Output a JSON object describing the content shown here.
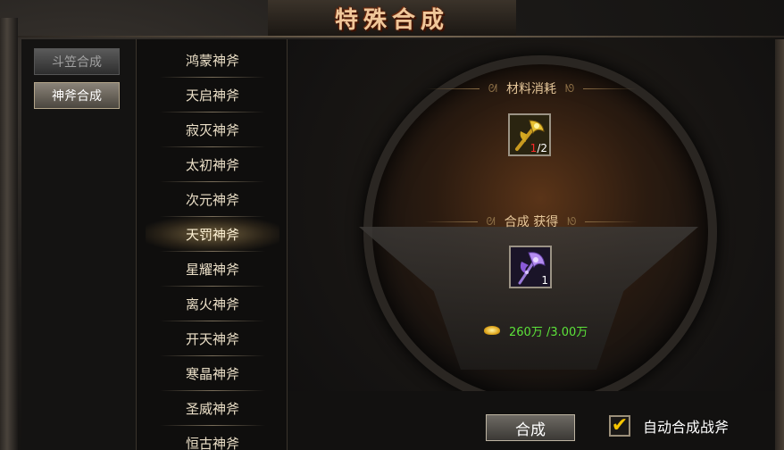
{
  "title": "特殊合成",
  "tabs": [
    {
      "label": "斗笠合成",
      "active": false
    },
    {
      "label": "神斧合成",
      "active": true
    }
  ],
  "list": [
    {
      "label": "鸿蒙神斧"
    },
    {
      "label": "天启神斧"
    },
    {
      "label": "寂灭神斧"
    },
    {
      "label": "太初神斧"
    },
    {
      "label": "次元神斧"
    },
    {
      "label": "天罚神斧",
      "selected": true
    },
    {
      "label": "星耀神斧"
    },
    {
      "label": "离火神斧"
    },
    {
      "label": "开天神斧"
    },
    {
      "label": "寒晶神斧"
    },
    {
      "label": "圣威神斧"
    },
    {
      "label": "恒古神斧"
    }
  ],
  "materials": {
    "title": "材料消耗",
    "item": {
      "icon": "golden-axe-icon",
      "have": "1",
      "need": "/2"
    }
  },
  "result": {
    "title": "合成 获得",
    "item": {
      "icon": "purple-axe-icon",
      "count": "1"
    }
  },
  "cost": {
    "icon": "gold-ingot-icon",
    "text": "260万 /3.00万"
  },
  "buttons": {
    "synthesize": "合成",
    "auto_label": "自动合成战斧",
    "auto_checked": true
  },
  "colors": {
    "title": "#f0c79a",
    "cost_text": "#5ce33a",
    "have_count": "#ff2a2a",
    "checkmark": "#f5c400"
  }
}
